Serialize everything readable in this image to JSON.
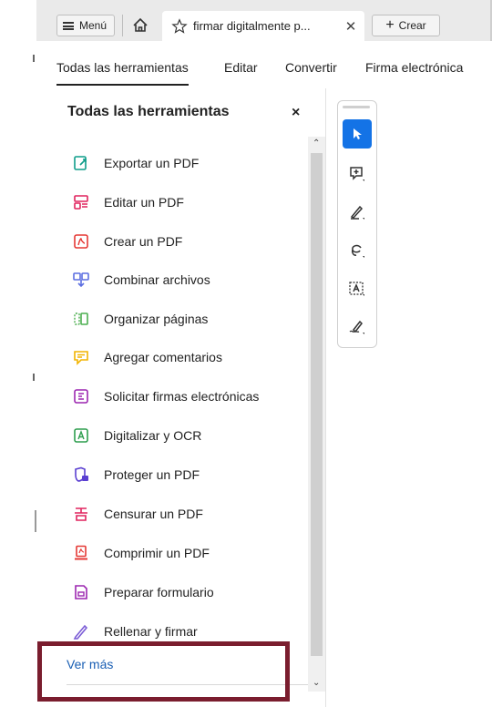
{
  "topbar": {
    "menu_label": "Menú",
    "tab_title": "firmar digitalmente p...",
    "create_label": "Crear"
  },
  "nav": {
    "tabs": [
      "Todas las herramientas",
      "Editar",
      "Convertir",
      "Firma electrónica"
    ]
  },
  "panel": {
    "title": "Todas las herramientas",
    "close": "×",
    "tools": [
      {
        "label": "Exportar un PDF",
        "icon": "export-pdf-icon",
        "color": "#0f9d8a"
      },
      {
        "label": "Editar un PDF",
        "icon": "edit-pdf-icon",
        "color": "#e0245e"
      },
      {
        "label": "Crear un PDF",
        "icon": "create-pdf-icon",
        "color": "#e53935"
      },
      {
        "label": "Combinar archivos",
        "icon": "combine-files-icon",
        "color": "#5b6ee1"
      },
      {
        "label": "Organizar páginas",
        "icon": "organize-pages-icon",
        "color": "#4caf50"
      },
      {
        "label": "Agregar comentarios",
        "icon": "comment-icon",
        "color": "#f2b400"
      },
      {
        "label": "Solicitar firmas electrónicas",
        "icon": "request-signature-icon",
        "color": "#9c27b0"
      },
      {
        "label": "Digitalizar y OCR",
        "icon": "scan-ocr-icon",
        "color": "#2e9e4f"
      },
      {
        "label": "Proteger un PDF",
        "icon": "protect-pdf-icon",
        "color": "#5a3fd1"
      },
      {
        "label": "Censurar un PDF",
        "icon": "redact-pdf-icon",
        "color": "#e0245e"
      },
      {
        "label": "Comprimir un PDF",
        "icon": "compress-pdf-icon",
        "color": "#e53935"
      },
      {
        "label": "Preparar formulario",
        "icon": "prepare-form-icon",
        "color": "#9c27b0"
      },
      {
        "label": "Rellenar y firmar",
        "icon": "fill-sign-icon",
        "color": "#7b5cd6"
      }
    ],
    "see_more": "Ver más"
  },
  "toolbar": {
    "buttons": [
      "select-cursor-icon",
      "add-comment-icon",
      "highlight-pen-icon",
      "lasso-draw-icon",
      "text-select-icon",
      "sign-pen-icon"
    ]
  },
  "colors": {
    "accent": "#1473e6",
    "highlight_box": "#7a1d2e",
    "link": "#1a5fb4"
  }
}
